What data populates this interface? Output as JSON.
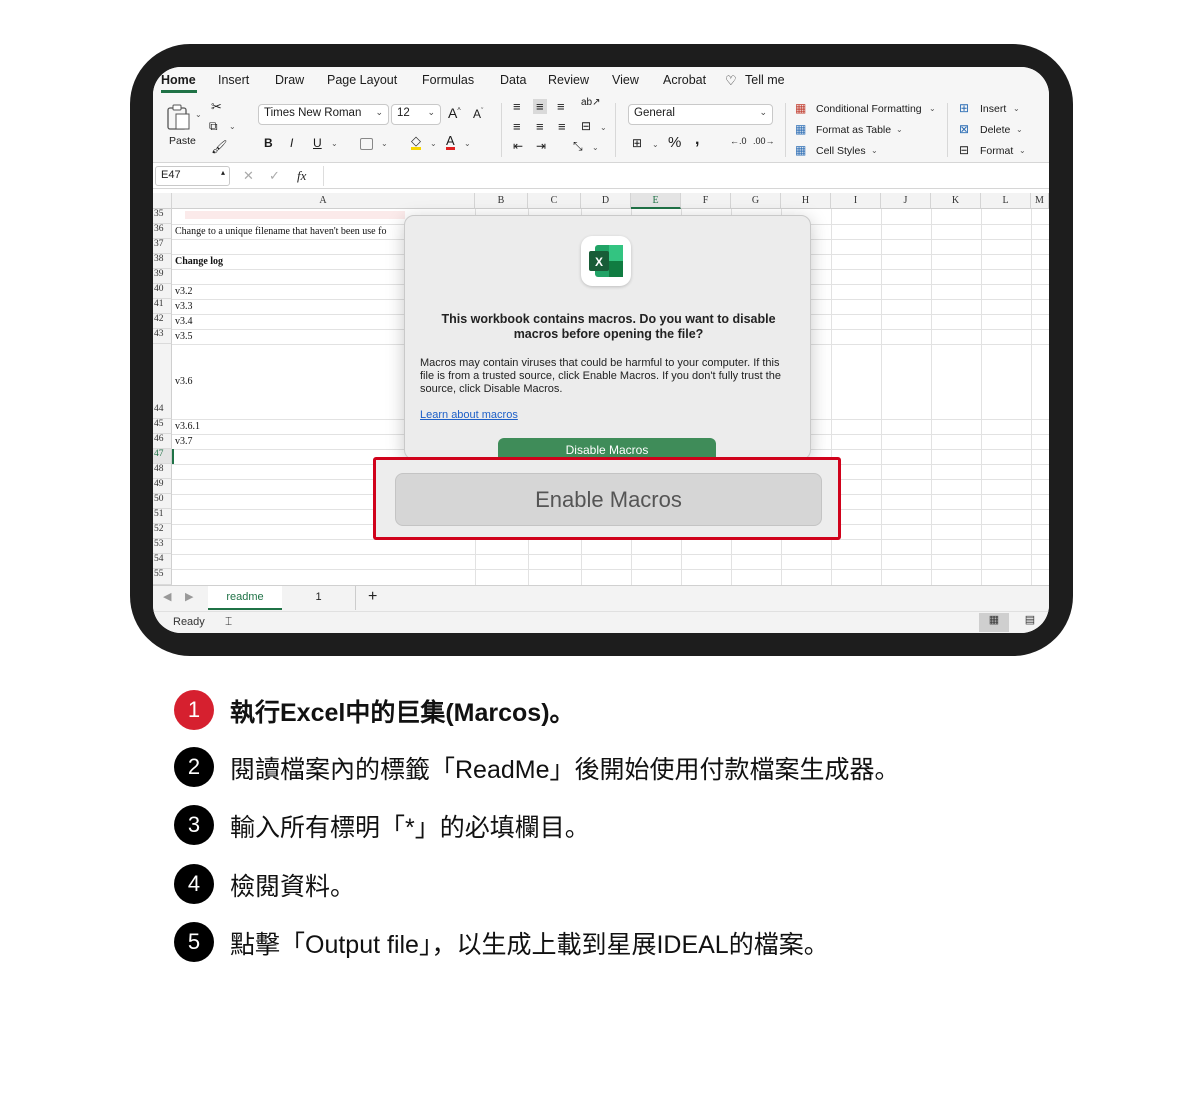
{
  "ribbon_tabs": [
    "Home",
    "Insert",
    "Draw",
    "Page Layout",
    "Formulas",
    "Data",
    "Review",
    "View",
    "Acrobat",
    "Tell me"
  ],
  "ribbon": {
    "paste_label": "Paste",
    "font_name": "Times New Roman",
    "font_size": "12",
    "bold": "B",
    "italic": "I",
    "underline": "U",
    "number_format": "General",
    "percent": "%",
    "comma": ",",
    "conditional_formatting": "Conditional Formatting",
    "format_as_table": "Format as Table",
    "cell_styles": "Cell Styles",
    "insert": "Insert",
    "delete": "Delete",
    "format": "Format"
  },
  "formula_bar": {
    "name_box": "E47",
    "fx": "fx"
  },
  "columns": [
    "A",
    "B",
    "C",
    "D",
    "E",
    "F",
    "G",
    "H",
    "I",
    "J",
    "K",
    "L",
    "M"
  ],
  "rows": [
    "35",
    "36",
    "37",
    "38",
    "39",
    "40",
    "41",
    "42",
    "43",
    "44",
    "45",
    "46",
    "47",
    "48",
    "49",
    "50",
    "51",
    "52",
    "53",
    "54",
    "55"
  ],
  "cells": {
    "r36": "Change to a unique filename that haven't been use fo",
    "r38": "Change log",
    "r40": "v3.2",
    "r41": "v3.3",
    "r42": "v3.4",
    "r43": "v3.5",
    "r43b": "v3.6",
    "r45": "v3.6.1",
    "r46": "v3.7"
  },
  "sheet_tabs": [
    "readme",
    "1"
  ],
  "add_sheet": "+",
  "status": "Ready",
  "dialog": {
    "title": "This workbook contains macros. Do you want to disable macros before opening the file?",
    "body": "Macros may contain viruses that could be harmful to your computer.  If this file is from a trusted source, click Enable Macros. If you don't fully trust the source, click Disable Macros.",
    "link": "Learn about macros",
    "disable_button": "Disable Macros",
    "enable_button": "Enable Macros",
    "logo_letter": "X"
  },
  "steps": [
    {
      "number": "1",
      "text": "執行Excel中的巨集(Marcos)。"
    },
    {
      "number": "2",
      "text": "閱讀檔案內的標籤「ReadMe」後開始使用付款檔案生成器。"
    },
    {
      "number": "3",
      "text": "輸入所有標明「*」的必填欄目。"
    },
    {
      "number": "4",
      "text": "檢閱資料。"
    },
    {
      "number": "5",
      "text": "點擊「Output file」，以生成上載到星展IDEAL的檔案。"
    }
  ],
  "colors": {
    "excel_green": "#1f7246",
    "disable_green": "#3f8c59",
    "highlight_red": "#d0021b",
    "step1_red": "#d6202f"
  }
}
